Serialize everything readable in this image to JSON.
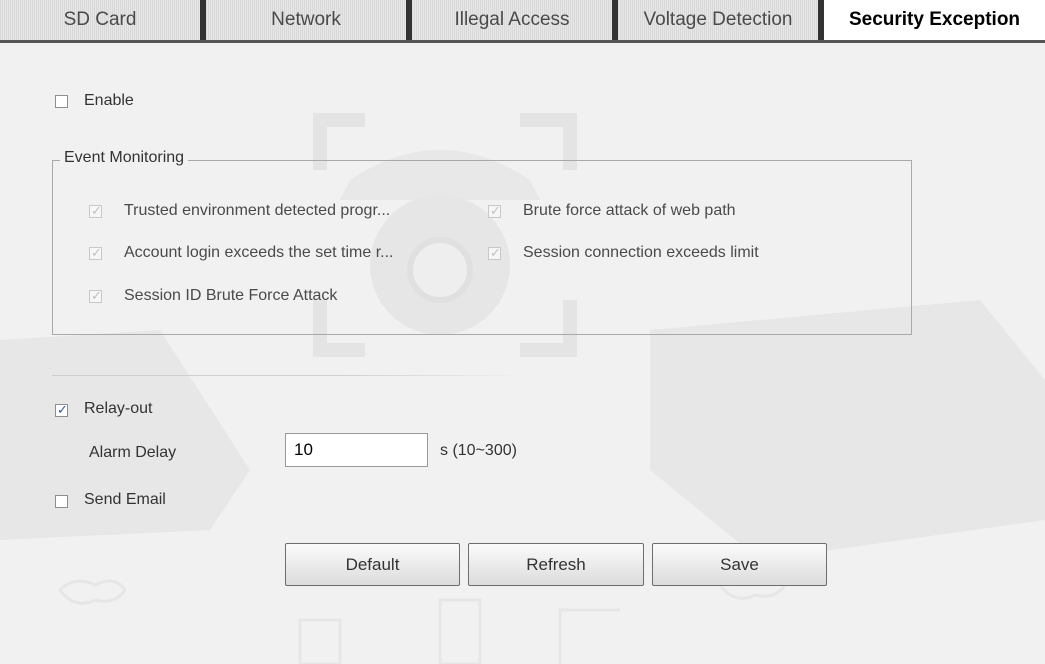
{
  "tabs": [
    {
      "label": "SD Card",
      "active": false
    },
    {
      "label": "Network",
      "active": false
    },
    {
      "label": "Illegal Access",
      "active": false
    },
    {
      "label": "Voltage Detection",
      "active": false
    },
    {
      "label": "Security Exception",
      "active": true
    }
  ],
  "enable": {
    "label": "Enable",
    "checked": false
  },
  "event_monitoring": {
    "legend": "Event Monitoring",
    "items": [
      {
        "label": "Trusted environment detected progr...",
        "checked": true,
        "disabled": true
      },
      {
        "label": "Brute force attack of web path",
        "checked": true,
        "disabled": true
      },
      {
        "label": "Account login exceeds the set time r...",
        "checked": true,
        "disabled": true
      },
      {
        "label": "Session connection exceeds limit",
        "checked": true,
        "disabled": true
      },
      {
        "label": "Session ID Brute Force Attack",
        "checked": true,
        "disabled": true
      }
    ]
  },
  "relay_out": {
    "label": "Relay-out",
    "checked": true
  },
  "alarm_delay": {
    "label": "Alarm Delay",
    "value": "10",
    "unit": "s (10~300)"
  },
  "send_email": {
    "label": "Send Email",
    "checked": false
  },
  "buttons": {
    "default": "Default",
    "refresh": "Refresh",
    "save": "Save"
  },
  "colors": {
    "background": "#f1f1f1",
    "check_blue": "#2a57a8",
    "disabled_check": "#c0c0c0"
  }
}
